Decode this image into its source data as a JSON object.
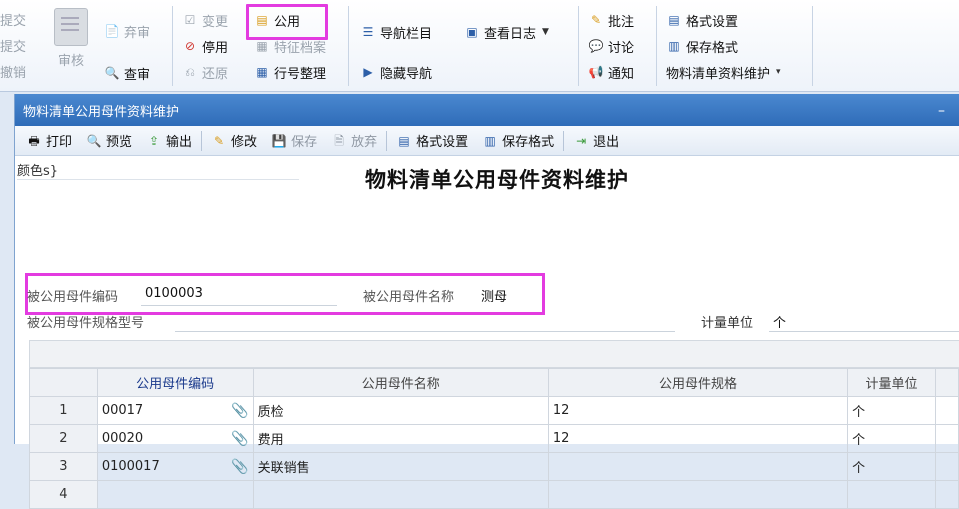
{
  "ribbon": {
    "left_partial": [
      "提交",
      "提交",
      "撤销"
    ],
    "audit": "审核",
    "abandon": "弃审",
    "check": "查审",
    "change": "变更",
    "disable": "停用",
    "restore": "还原",
    "public": "公用",
    "feature_archive": "特征档案",
    "row_organize": "行号整理",
    "nav_bar": "导航栏目",
    "view_log": "查看日志",
    "hide_nav": "隐藏导航",
    "annotate": "批注",
    "discuss": "讨论",
    "notify": "通知",
    "format_settings": "格式设置",
    "save_format": "保存格式",
    "bom_maint": "物料清单资料维护"
  },
  "window": {
    "title": "物料清单公用母件资料维护",
    "minimize": "–"
  },
  "toolbar": {
    "print": "打印",
    "preview": "预览",
    "export": "输出",
    "edit": "修改",
    "save": "保存",
    "discard": "放弃",
    "format_settings": "格式设置",
    "save_format": "保存格式",
    "exit": "退出"
  },
  "form": {
    "color_label": "颜色s}",
    "title": "物料清单公用母件资料维护",
    "parent_code_label": "被公用母件编码",
    "parent_code_value": "0100003",
    "parent_name_label": "被公用母件名称",
    "parent_name_value": "测母",
    "parent_spec_label": "被公用母件规格型号",
    "unit_label": "计量单位",
    "unit_value": "个"
  },
  "grid": {
    "headers": [
      "",
      "公用母件编码",
      "公用母件名称",
      "公用母件规格",
      "计量单位"
    ],
    "rows": [
      {
        "no": "1",
        "code": "00017",
        "name": "质检",
        "spec": "12",
        "unit": "个"
      },
      {
        "no": "2",
        "code": "00020",
        "name": "费用",
        "spec": "12",
        "unit": "个"
      },
      {
        "no": "3",
        "code": "0100017",
        "name": "关联销售",
        "spec": "",
        "unit": "个"
      },
      {
        "no": "4",
        "code": "",
        "name": "",
        "spec": "",
        "unit": ""
      }
    ]
  },
  "colors": {
    "highlight": "#e33be0",
    "titlebar": "#3a78c4",
    "header_text": "#1b3a8c"
  }
}
